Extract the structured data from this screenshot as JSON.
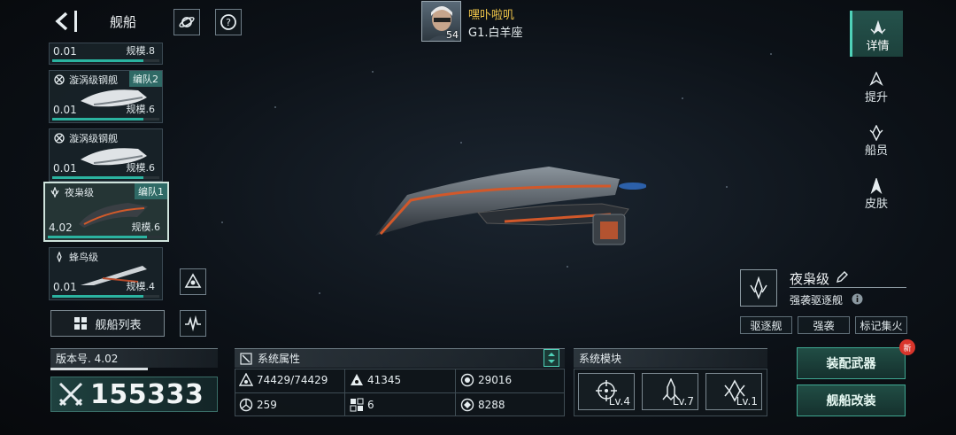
{
  "header": {
    "title": "舰船",
    "player_name": "嘿卟啦叽",
    "player_level": "54",
    "player_server": "G1.白羊座"
  },
  "ship_list": [
    {
      "name": "",
      "team": "",
      "value": "0.01",
      "scale": "规模.8",
      "bar_fraction": 0.85,
      "selected": false
    },
    {
      "name": "漩涡级钢舰",
      "team": "编队2",
      "value": "0.01",
      "scale": "规模.6",
      "bar_fraction": 0.85,
      "selected": false
    },
    {
      "name": "漩涡级钢舰",
      "team": "",
      "value": "0.01",
      "scale": "规模.6",
      "bar_fraction": 0.85,
      "selected": false
    },
    {
      "name": "夜枭级",
      "team": "编队1",
      "value": "4.02",
      "scale": "规模.6",
      "bar_fraction": 0.85,
      "selected": true
    },
    {
      "name": "蜂鸟级",
      "team": "",
      "value": "0.01",
      "scale": "规模.4",
      "bar_fraction": 0.85,
      "selected": false
    }
  ],
  "list_button": "舰船列表",
  "nav": [
    {
      "label": "详情",
      "active": true
    },
    {
      "label": "提升",
      "active": false
    },
    {
      "label": "船员",
      "active": false
    },
    {
      "label": "皮肤",
      "active": false
    }
  ],
  "ship_info": {
    "name": "夜枭级",
    "type": "强袭驱逐舰",
    "tags": [
      "驱逐舰",
      "强袭",
      "标记集火"
    ]
  },
  "version": {
    "label": "版本号. 4.02",
    "power": "155333"
  },
  "attributes": {
    "title": "系统属性",
    "stats": [
      {
        "icon": "armor-icon",
        "value": "74429/74429"
      },
      {
        "icon": "firepower-icon",
        "value": "41345"
      },
      {
        "icon": "shield-icon",
        "value": "29016"
      },
      {
        "icon": "speed-icon",
        "value": "259"
      },
      {
        "icon": "grid-icon",
        "value": "6"
      },
      {
        "icon": "target-icon",
        "value": "8288"
      }
    ]
  },
  "modules": {
    "title": "系统模块",
    "items": [
      {
        "icon": "crosshair-module-icon",
        "level": "Lv.4"
      },
      {
        "icon": "missile-module-icon",
        "level": "Lv.7"
      },
      {
        "icon": "drone-module-icon",
        "level": "Lv.1"
      }
    ]
  },
  "actions": {
    "equip": "装配武器",
    "refit": "舰船改装",
    "new_badge": "新"
  }
}
